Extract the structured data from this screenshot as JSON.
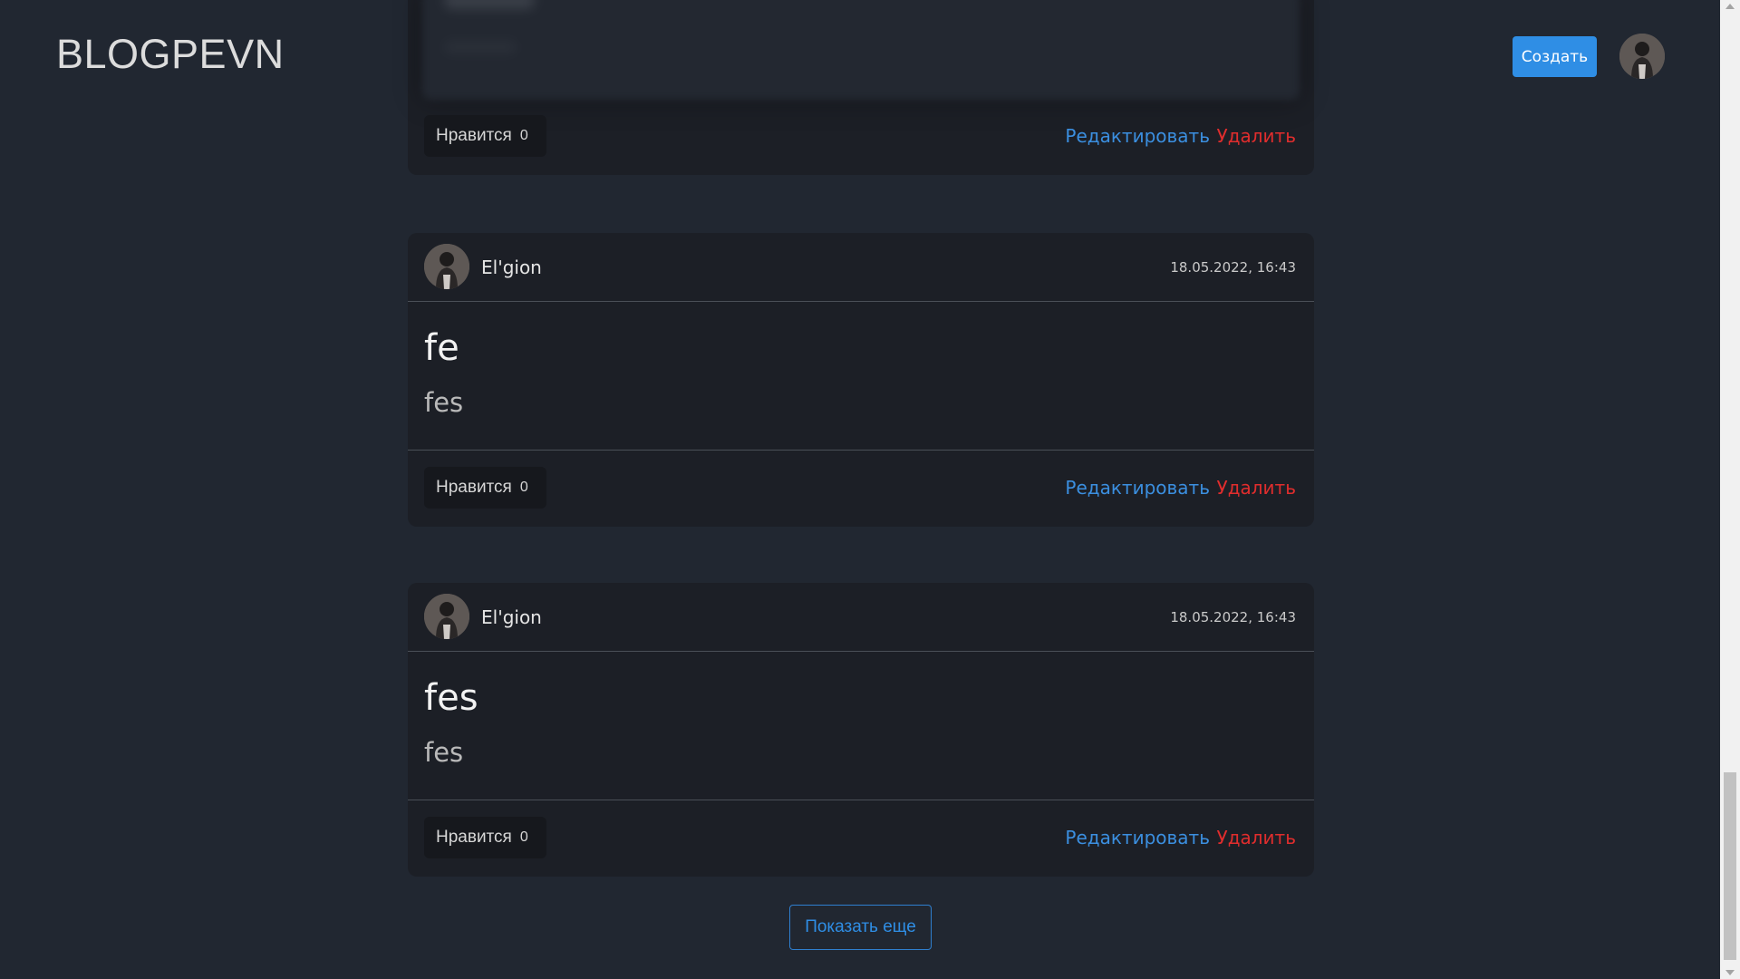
{
  "brand": "BLOGPEVN",
  "header": {
    "create_label": "Создать",
    "avatar_icon": "user-avatar-icon"
  },
  "posts": [
    {
      "partial": true,
      "like_label": "Нравится",
      "likes": "0",
      "edit_label": "Редактировать",
      "delete_label": "Удалить"
    },
    {
      "author": "El'gion",
      "date": "18.05.2022, 16:43",
      "title": "fe",
      "text": "fes",
      "like_label": "Нравится",
      "likes": "0",
      "edit_label": "Редактировать",
      "delete_label": "Удалить"
    },
    {
      "author": "El'gion",
      "date": "18.05.2022, 16:43",
      "title": "fes",
      "text": "fes",
      "like_label": "Нравится",
      "likes": "0",
      "edit_label": "Редактировать",
      "delete_label": "Удалить"
    }
  ],
  "show_more_label": "Показать еще",
  "colors": {
    "background": "#212731",
    "card": "#1c1f26",
    "primary": "#2f8ee5",
    "danger": "#e02d2d"
  }
}
